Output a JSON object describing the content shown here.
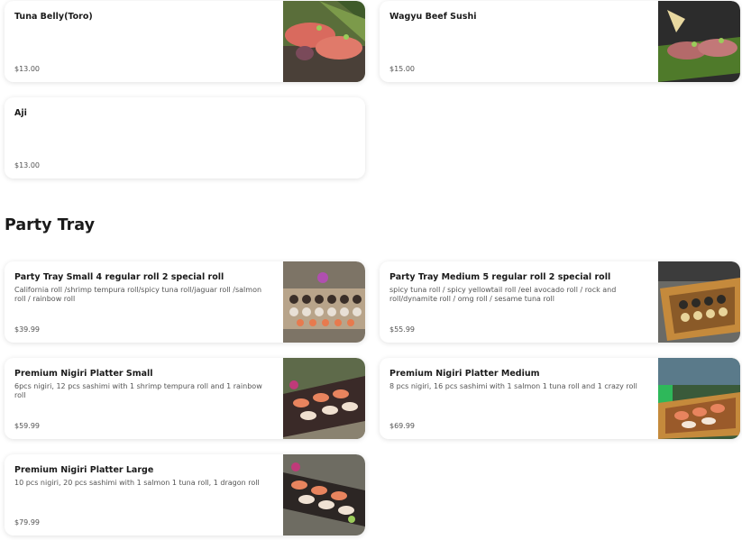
{
  "top_items": [
    {
      "name": "Tuna Belly(Toro)",
      "description": "",
      "price": "$13.00",
      "image": "toro-sashimi-photo"
    },
    {
      "name": "Wagyu Beef Sushi",
      "description": "",
      "price": "$15.00",
      "image": "wagyu-nigiri-photo"
    },
    {
      "name": "Aji",
      "description": "",
      "price": "$13.00",
      "image": ""
    }
  ],
  "party_tray": {
    "heading": "Party Tray",
    "items": [
      {
        "name": "Party Tray Small 4 regular roll 2 special roll",
        "description": "California roll /shrimp tempura roll/spicy tuna roll/jaguar roll /salmon roll / rainbow roll",
        "price": "$39.99",
        "image": "roll-platter-photo"
      },
      {
        "name": "Party Tray Medium 5 regular roll 2 special roll",
        "description": "spicy tuna roll / spicy yellowtail roll /eel avocado roll / rock and roll/dynamite roll / omg roll / sesame tuna roll",
        "price": "$55.99",
        "image": "sushi-boat-photo"
      },
      {
        "name": "Premium Nigiri Platter Small",
        "description": "6pcs nigiri, 12 pcs sashimi with 1 shrimp tempura roll and 1 rainbow roll",
        "price": "$59.99",
        "image": "nigiri-platter-photo"
      },
      {
        "name": "Premium Nigiri Platter Medium",
        "description": "8 pcs nigiri, 16 pcs sashimi with 1 salmon 1 tuna roll and 1 crazy roll",
        "price": "$69.99",
        "image": "sashimi-boat-photo"
      },
      {
        "name": "Premium Nigiri Platter Large",
        "description": "10 pcs nigiri, 20 pcs sashimi with 1 salmon 1 tuna roll, 1 dragon roll",
        "price": "$79.99",
        "image": "large-platter-photo"
      }
    ]
  }
}
